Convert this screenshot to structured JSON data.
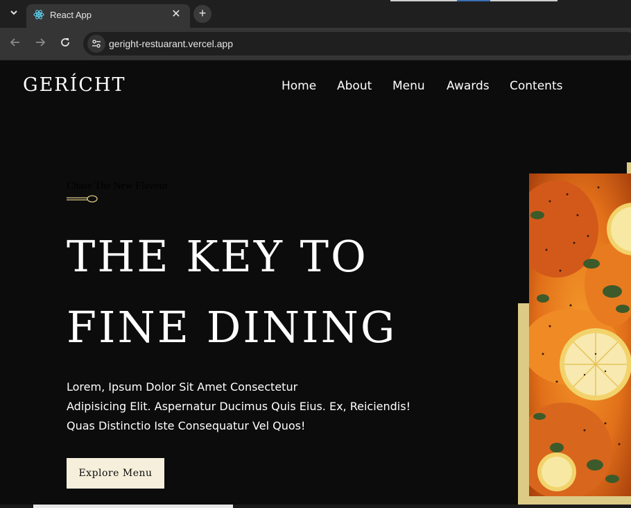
{
  "browser": {
    "tab_title": "React App",
    "url": "geright-restuarant.vercel.app",
    "icons": {
      "tab_menu": "chevron-down-icon",
      "favicon": "react-icon",
      "close": "close-icon",
      "new_tab": "plus-icon",
      "back": "arrow-left-icon",
      "forward": "arrow-right-icon",
      "reload": "reload-icon",
      "site_info": "site-settings-icon"
    }
  },
  "header": {
    "logo": "GERÍCHT",
    "nav": [
      "Home",
      "About",
      "Menu",
      "Awards",
      "Contents"
    ]
  },
  "hero": {
    "subtitle": "Chase The New Flavour",
    "headline_line1": "THE KEY TO",
    "headline_line2": "FINE DINING",
    "description": [
      "Lorem, Ipsum Dolor Sit Amet Consectetur",
      "Adipisicing Elit. Aspernatur Ducimus Quis Eius. Ex, Reiciendis!",
      "Quas Distinctio Iste Consequatur Vel Quos!"
    ],
    "cta": "Explore Menu"
  },
  "colors": {
    "background": "#0c0c0c",
    "gold": "#dcca87",
    "cream": "#f5efdb",
    "white": "#ffffff"
  }
}
